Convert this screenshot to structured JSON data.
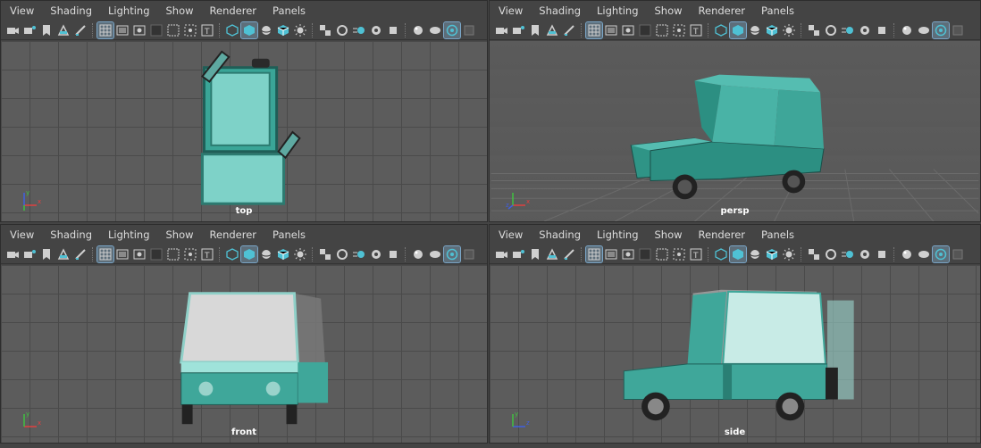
{
  "menu": [
    "View",
    "Shading",
    "Lighting",
    "Show",
    "Renderer",
    "Panels"
  ],
  "panes": [
    {
      "id": "tl",
      "camera": "top"
    },
    {
      "id": "tr",
      "camera": "persp"
    },
    {
      "id": "bl",
      "camera": "front"
    },
    {
      "id": "br",
      "camera": "side"
    }
  ],
  "toolbar_icons": [
    "camera-select-icon",
    "camera-attr-icon",
    "bookmark-icon",
    "image-plane-icon",
    "grease-pencil-icon",
    "sep",
    "grid-icon",
    "film-gate-icon",
    "resolution-gate-icon",
    "gate-mask-icon",
    "field-chart-icon",
    "safe-action-icon",
    "safe-title-icon",
    "sep",
    "wireframe-icon",
    "smooth-shade-icon",
    "wireframe-on-shaded-icon",
    "textured-icon",
    "use-lights-icon",
    "sep",
    "shadows-icon",
    "ambient-occlusion-icon",
    "motion-blur-icon",
    "anti-alias-icon",
    "isolate-select-icon",
    "sep",
    "xray-icon",
    "xray-active-icon",
    "xray-joints-icon",
    "backface-icon"
  ],
  "active_icons": [
    "grid-icon",
    "smooth-shade-icon",
    "xray-joints-icon"
  ],
  "axes": {
    "x": "x",
    "y": "y",
    "z": "z"
  },
  "colors": {
    "car_body": "#3fa79a",
    "car_light": "#9fe3da",
    "car_dark": "#1f6b62",
    "viewport": "#5c5c5c",
    "active_icon": "#5d6e7a"
  }
}
